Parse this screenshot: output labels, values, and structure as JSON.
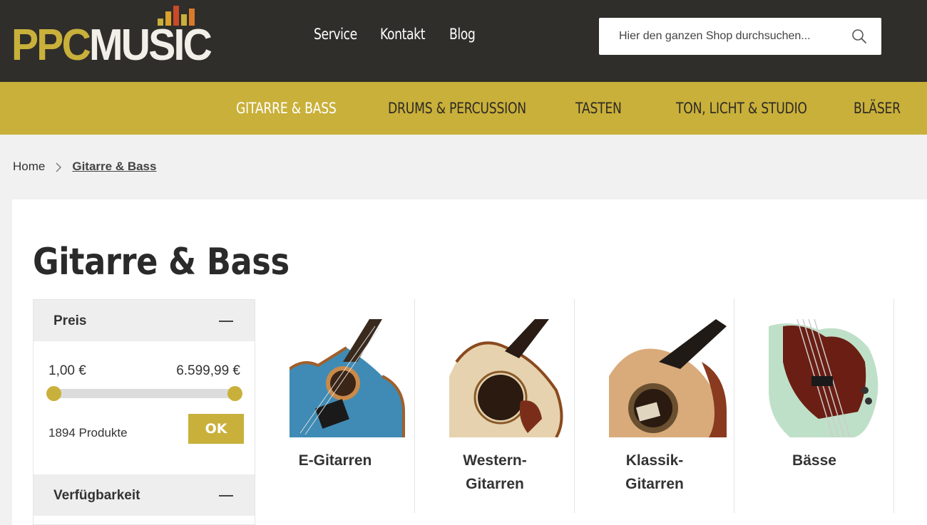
{
  "brand": {
    "logo_part1": "PPC",
    "logo_part2": "MUSIC",
    "colors": {
      "gold": "#c9b03a",
      "dark": "#302e2b",
      "white": "#ffffff"
    }
  },
  "topnav": [
    "Service",
    "Kontakt",
    "Blog"
  ],
  "search": {
    "placeholder": "Hier den ganzen Shop durchsuchen...",
    "icon": "search-icon"
  },
  "categories": [
    "GITARRE & BASS",
    "DRUMS & PERCUSSION",
    "TASTEN",
    "TON, LICHT & STUDIO",
    "BLÄSER"
  ],
  "active_category": "GITARRE & BASS",
  "breadcrumb": {
    "home": "Home",
    "current": "Gitarre & Bass",
    "separator_icon": "chevron-right-icon"
  },
  "page_title": "Gitarre & Bass",
  "filters": {
    "price": {
      "label": "Preis",
      "min": "1,00 €",
      "max": "6.599,99 €",
      "range_fraction": [
        0,
        1
      ],
      "product_count": "1894 Produkte",
      "ok_label": "OK"
    },
    "availability": {
      "label": "Verfügbarkeit"
    }
  },
  "subcategories": [
    {
      "line1": "E-Gitarren",
      "line2": "",
      "image": "electric-guitar-image"
    },
    {
      "line1": "Western-",
      "line2": "Gitarren",
      "image": "western-guitar-image"
    },
    {
      "line1": "Klassik-",
      "line2": "Gitarren",
      "image": "classical-guitar-image"
    },
    {
      "line1": "Bässe",
      "line2": "",
      "image": "bass-guitar-image"
    }
  ]
}
